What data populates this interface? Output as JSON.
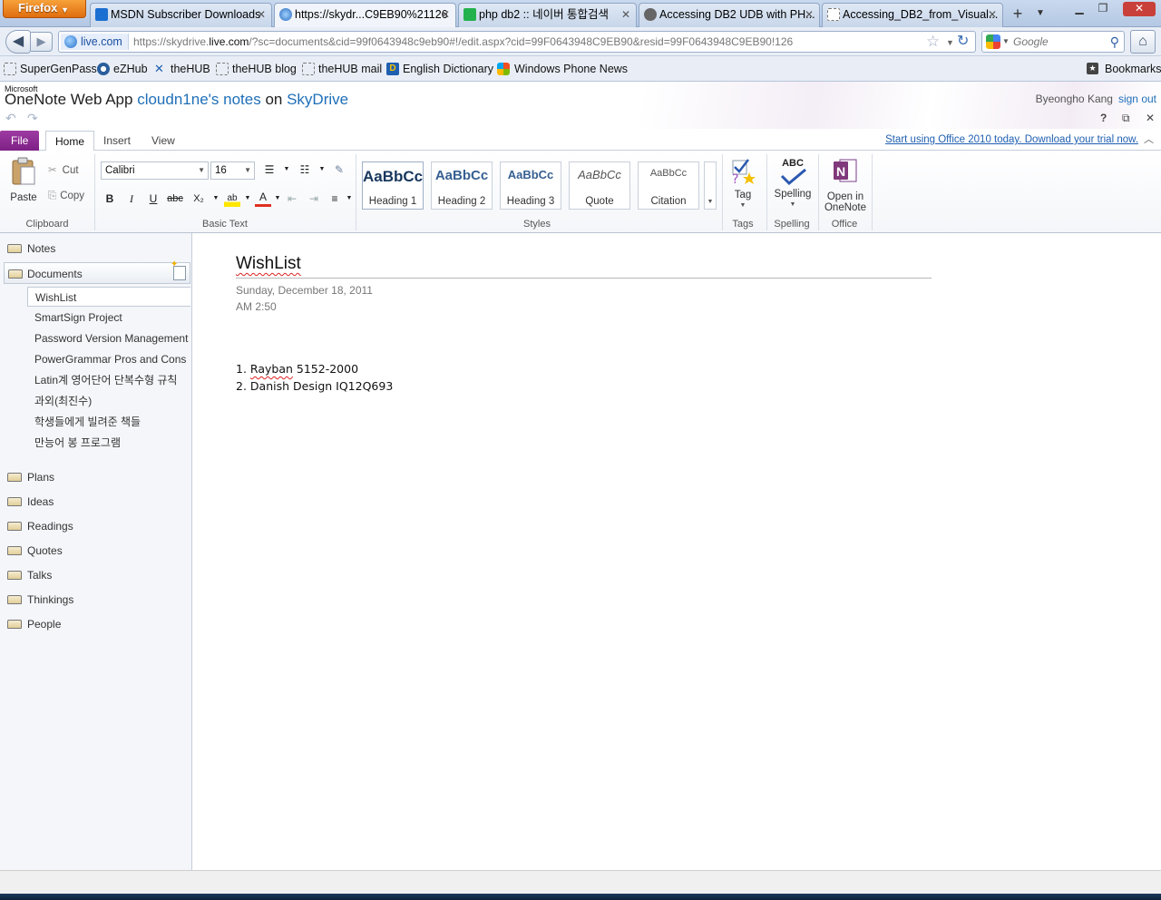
{
  "browser": {
    "menu_button": "Firefox",
    "tabs": [
      {
        "title": "MSDN Subscriber Downloads",
        "icon_color": "#1b6fd1"
      },
      {
        "title": "https://skydr...C9EB90%21126",
        "icon_color": "#2d6cc0"
      },
      {
        "title": "php db2 :: 네이버 통합검색",
        "icon_color": "#22b14c"
      },
      {
        "title": "Accessing DB2 UDB with PH...",
        "icon_color": "#555555"
      },
      {
        "title": "Accessing_DB2_from_Visual...",
        "icon_color": "#ffffff"
      }
    ],
    "new_tab": "+",
    "url_site": "live.com",
    "url_prefix": "https://skydrive.",
    "url_host": "live.com",
    "url_rest": "/?sc=documents&cid=99f0643948c9eb90#!/edit.aspx?cid=99F0643948C9EB90&resid=99F0643948C9EB90!126",
    "search_placeholder": "Google",
    "bookmarks": [
      "SuperGenPass",
      "eZHub",
      "theHUB",
      "theHUB blog",
      "theHUB mail",
      "English Dictionary",
      "Windows Phone News"
    ],
    "bookmarks_menu": "Bookmarks"
  },
  "app": {
    "microsoft": "Microsoft",
    "product": "OneNote Web App",
    "notebook": "cloudn1ne's notes",
    "on": "on",
    "service": "SkyDrive",
    "user_name": "Byeongho Kang",
    "sign_out": "sign out"
  },
  "ribbon": {
    "tabs": {
      "file": "File",
      "home": "Home",
      "insert": "Insert",
      "view": "View"
    },
    "promo": "Start using Office 2010 today. Download your trial now.",
    "clipboard": {
      "paste": "Paste",
      "cut": "Cut",
      "copy": "Copy",
      "label": "Clipboard"
    },
    "basic_text": {
      "font": "Calibri",
      "size": "16",
      "label": "Basic Text"
    },
    "styles": {
      "items": [
        {
          "sample": "AaBbCc",
          "name": "Heading 1"
        },
        {
          "sample": "AaBbCc",
          "name": "Heading 2"
        },
        {
          "sample": "AaBbCc",
          "name": "Heading 3"
        },
        {
          "sample": "AaBbCc",
          "name": "Quote"
        },
        {
          "sample": "AaBbCc",
          "name": "Citation"
        }
      ],
      "label": "Styles"
    },
    "tags": {
      "tag": "Tag",
      "label": "Tags"
    },
    "spelling": {
      "icon_text": "ABC",
      "spelling": "Spelling",
      "label": "Spelling"
    },
    "office": {
      "open_line1": "Open in",
      "open_line2": "OneNote",
      "label": "Office"
    }
  },
  "nav": {
    "sections_top": [
      "Notes",
      "Documents"
    ],
    "pages": [
      "WishList",
      "SmartSign Project",
      "Password Version Management",
      "PowerGrammar Pros and Cons",
      "Latin계 영어단어 단복수형 규칙",
      "과외(최진수)",
      "학생들에게 빌려준 책들",
      "만능어 봉 프로그램"
    ],
    "sections_bottom": [
      "Plans",
      "Ideas",
      "Readings",
      "Quotes",
      "Talks",
      "Thinkings",
      "People"
    ]
  },
  "page": {
    "title": "WishList",
    "date": "Sunday, December 18, 2011",
    "time": "AM 2:50",
    "items": [
      {
        "num": "1.",
        "first": "Rayban",
        "rest": " 5152-2000"
      },
      {
        "num": "2.",
        "first": "Danish",
        "rest": " Design IQ12Q693"
      }
    ]
  }
}
